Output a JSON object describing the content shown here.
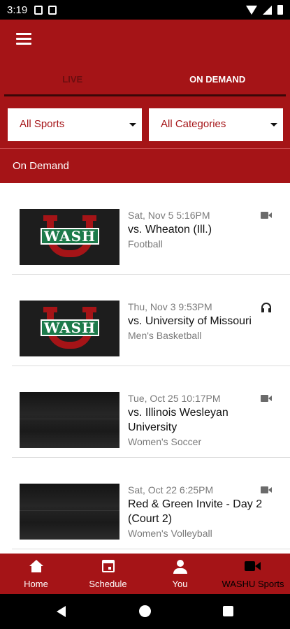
{
  "status_bar": {
    "time": "3:19",
    "icons": [
      "sim-icon",
      "sync-icon",
      "wifi-icon",
      "signal-icon",
      "battery-icon"
    ]
  },
  "app_bar": {
    "menu_icon": "hamburger-menu-icon"
  },
  "tabs": [
    {
      "label": "LIVE",
      "active": false
    },
    {
      "label": "ON DEMAND",
      "active": true
    }
  ],
  "filters": {
    "sport": {
      "value": "All Sports"
    },
    "category": {
      "value": "All Categories"
    }
  },
  "section": {
    "title": "On Demand"
  },
  "items": [
    {
      "date": "Sat, Nov 5 5:16PM",
      "title": "vs. Wheaton (Ill.)",
      "category": "Football",
      "media": "video-icon",
      "thumb": "logo",
      "logo_text": "WASH"
    },
    {
      "date": "Thu, Nov 3 9:53PM",
      "title": "vs. University of Missouri",
      "category": "Men's Basketball",
      "media": "headphones-icon",
      "thumb": "logo",
      "logo_text": "WASH"
    },
    {
      "date": "Tue, Oct 25 10:17PM",
      "title": "vs. Illinois Wesleyan University",
      "category": "Women's Soccer",
      "media": "video-icon",
      "thumb": "stadium"
    },
    {
      "date": "Sat, Oct 22 6:25PM",
      "title": "Red & Green Invite - Day 2 (Court 2)",
      "category": "Women's Volleyball",
      "media": "video-icon",
      "thumb": "stadium"
    }
  ],
  "bottom_nav": [
    {
      "label": "Home",
      "icon": "home-icon"
    },
    {
      "label": "Schedule",
      "icon": "calendar-icon"
    },
    {
      "label": "You",
      "icon": "person-icon"
    },
    {
      "label": "WASHU Sports",
      "icon": "video-camera-icon",
      "active": true
    }
  ],
  "colors": {
    "brand_red": "#a51417",
    "logo_green": "#1c7a4a",
    "muted_text": "#7a7a7a"
  }
}
